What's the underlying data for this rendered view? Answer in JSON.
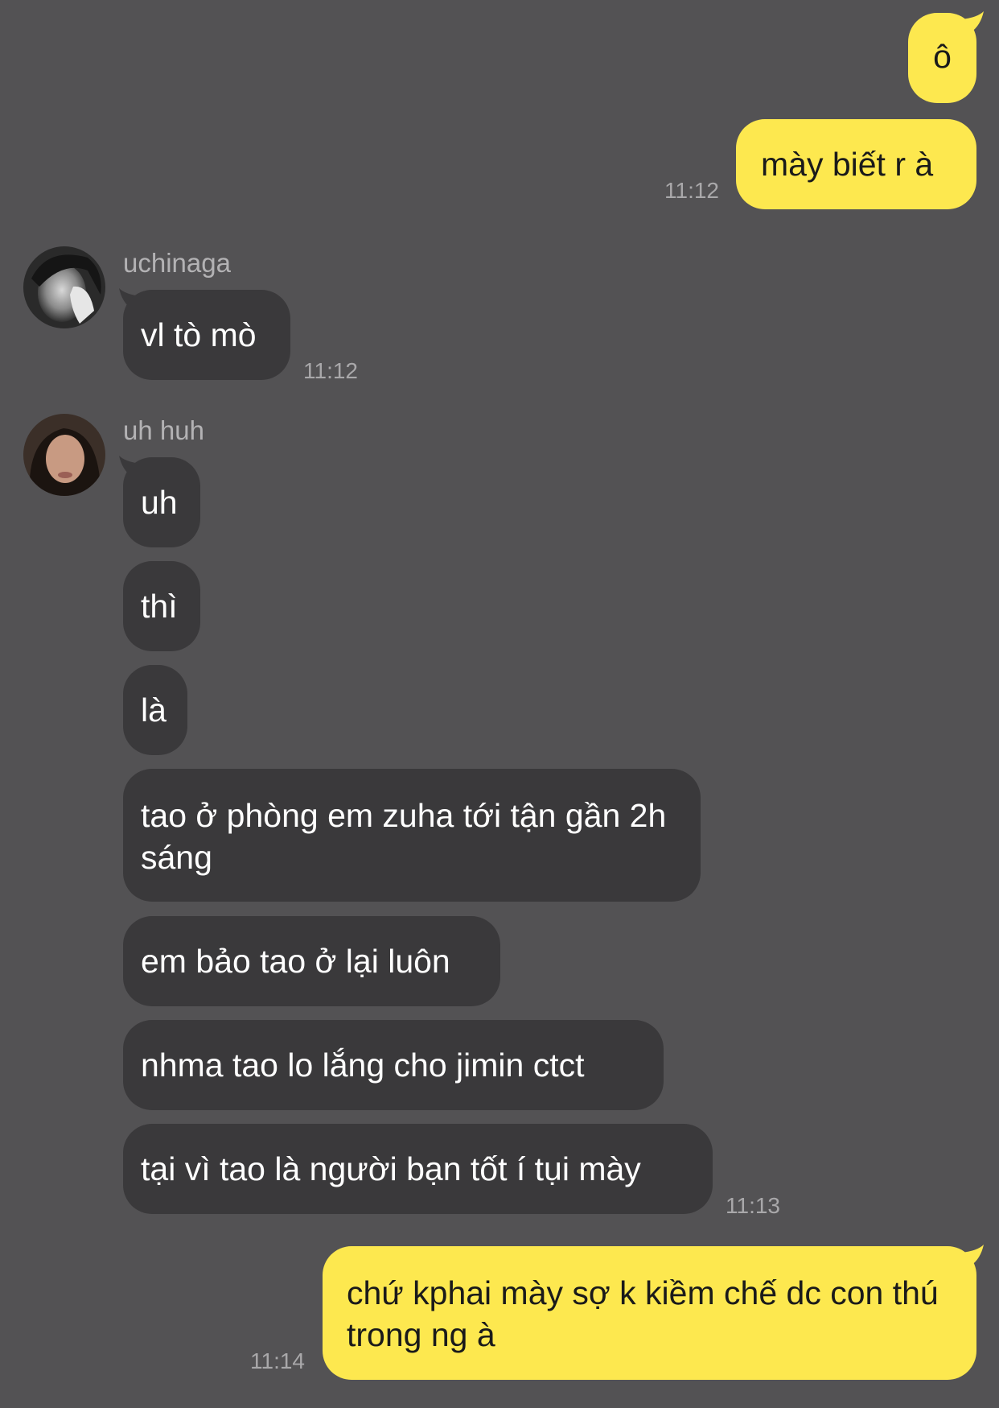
{
  "colors": {
    "background": "#535254",
    "outgoing_bubble": "#FDE84F",
    "incoming_bubble": "#3A393B",
    "timestamp": "#A9A8AA"
  },
  "chat": {
    "out1": {
      "text": "ô"
    },
    "out2": {
      "text": "mày biết r à",
      "time": "11:12"
    },
    "group1": {
      "sender": "uchinaga",
      "avatar_icon": "avatar-photo-grayscale",
      "messages": [
        "vl tò mò"
      ],
      "time": "11:12"
    },
    "group2": {
      "sender": "uh huh",
      "avatar_icon": "avatar-photo-portrait",
      "messages": [
        "uh",
        "thì",
        "là",
        "tao ở phòng em zuha tới tận gần 2h sáng",
        "em bảo tao ở lại luôn",
        "nhma tao lo lắng cho jimin ctct",
        "tại vì tao là người bạn tốt í tụi mày"
      ],
      "time": "11:13"
    },
    "out3": {
      "text": "chứ kphai mày sợ k kiềm chế dc con thú trong ng à",
      "time": "11:14"
    }
  }
}
